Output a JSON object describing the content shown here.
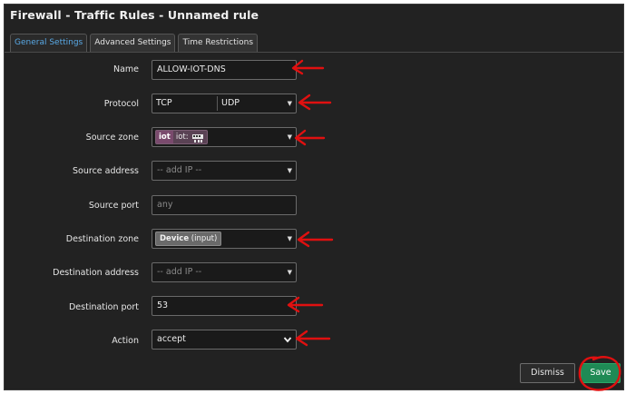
{
  "title": "Firewall - Traffic Rules - Unnamed rule",
  "tabs": [
    {
      "label": "General Settings",
      "active": true
    },
    {
      "label": "Advanced Settings",
      "active": false
    },
    {
      "label": "Time Restrictions",
      "active": false
    }
  ],
  "fields": {
    "name": {
      "label": "Name",
      "value": "ALLOW-IOT-DNS"
    },
    "protocol": {
      "label": "Protocol",
      "values": [
        "TCP",
        "UDP"
      ]
    },
    "source_zone": {
      "label": "Source zone",
      "zone": "iot",
      "text": "iot:"
    },
    "source_address": {
      "label": "Source address",
      "placeholder": "-- add IP --"
    },
    "source_port": {
      "label": "Source port",
      "placeholder": "any"
    },
    "destination_zone": {
      "label": "Destination zone",
      "value_bold": "Device",
      "value_rest": "(input)"
    },
    "destination_address": {
      "label": "Destination address",
      "placeholder": "-- add IP --"
    },
    "destination_port": {
      "label": "Destination port",
      "value": "53"
    },
    "action": {
      "label": "Action",
      "value": "accept"
    }
  },
  "buttons": {
    "dismiss": "Dismiss",
    "save": "Save"
  },
  "icons": {
    "network": "network-icon",
    "caret": "caret-down-icon",
    "chevron": "chevron-down-icon"
  },
  "colors": {
    "background": "#222222",
    "active_tab": "#59a9e6",
    "save": "#1f8a55",
    "zone_iot": "#7a4a6d",
    "annotation": "#e01010"
  }
}
